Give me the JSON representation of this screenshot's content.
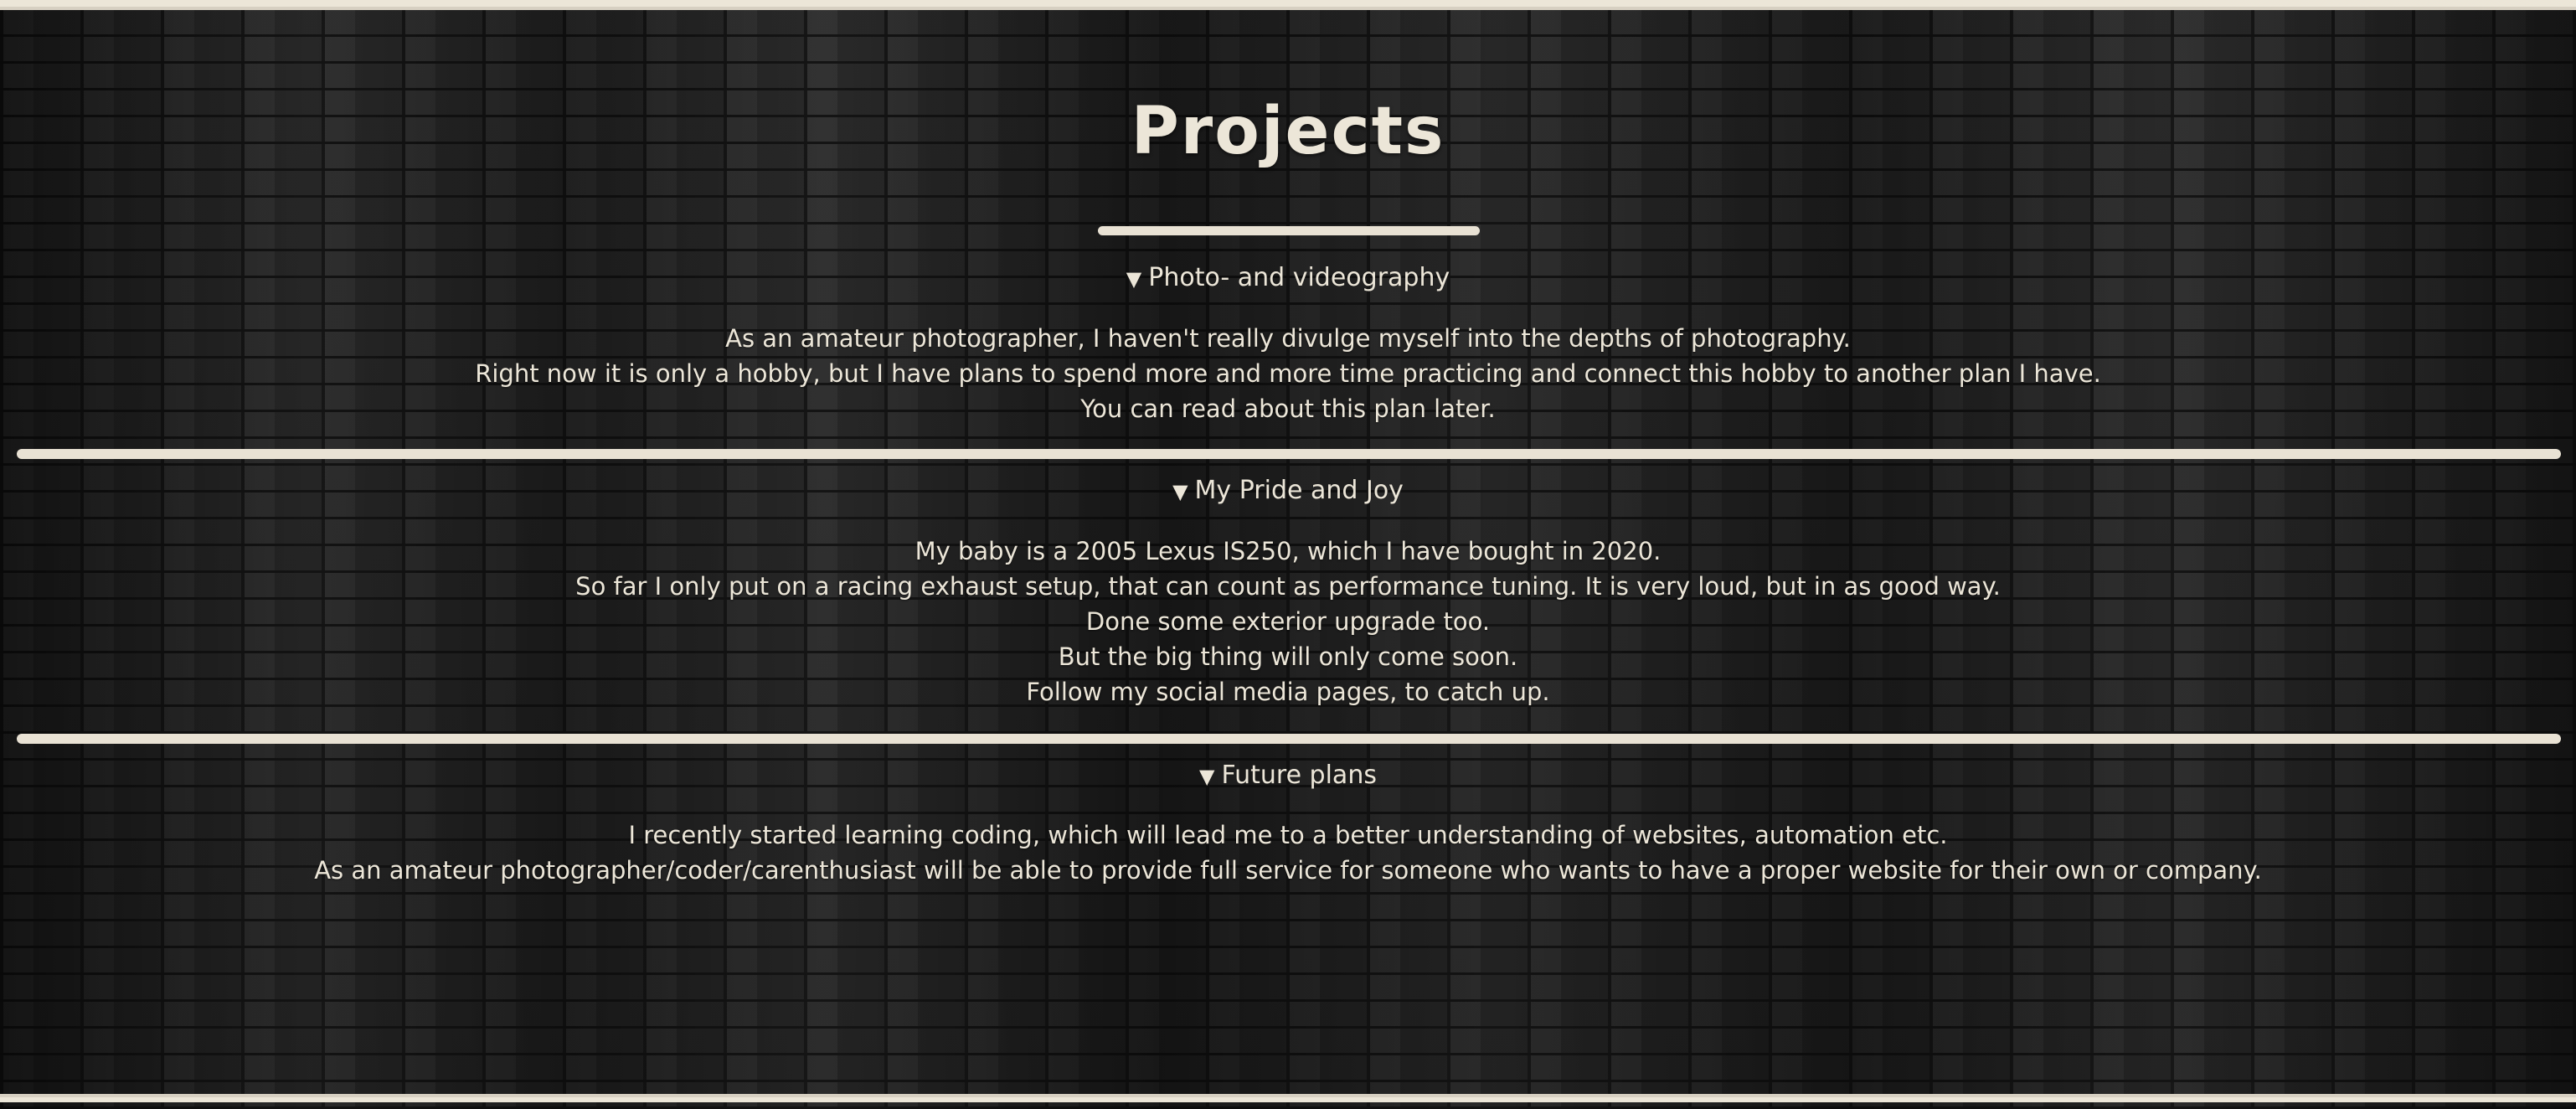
{
  "page": {
    "title": "Projects"
  },
  "sections": [
    {
      "summary": "Photo- and videography",
      "toggle_icon": "▼",
      "lines": [
        "As an amateur photographer, I haven't really divulge myself into the depths of photography.",
        "Right now it is only a hobby, but I have plans to spend more and more time practicing and connect this hobby to another plan I have.",
        "You can read about this plan later."
      ]
    },
    {
      "summary": "My Pride and Joy",
      "toggle_icon": "▼",
      "lines": [
        "My baby is a 2005 Lexus IS250, which I have bought in 2020.",
        "So far I only put on a racing exhaust setup, that can count as performance tuning. It is very loud, but in as good way.",
        "Done some exterior upgrade too.",
        "But the big thing will only come soon.",
        "Follow my social media pages, to catch up."
      ]
    },
    {
      "summary": "Future plans",
      "toggle_icon": "▼",
      "lines": [
        "I recently started learning coding, which will lead me to a better understanding of websites, automation etc.",
        "As an amateur photographer/coder/carenthusiast will be able to provide full service for someone who wants to have a proper website for their own or company."
      ]
    }
  ],
  "colors": {
    "text": "#ece6d8",
    "divider": "#e9e2d4",
    "background": "#222222"
  },
  "icons": {
    "disclosure": "triangle-down-icon"
  }
}
